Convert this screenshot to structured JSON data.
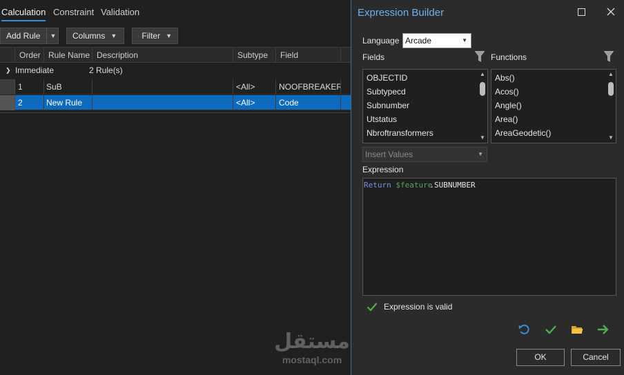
{
  "tabs": [
    "Calculation",
    "Constraint",
    "Validation"
  ],
  "toolbar": {
    "add_rule": "Add Rule",
    "columns": "Columns",
    "filter": "Filter"
  },
  "grid": {
    "columns": [
      "Order",
      "Rule Name",
      "Description",
      "Subtype",
      "Field"
    ],
    "group": {
      "name": "Immediate",
      "count": "2 Rule(s)"
    },
    "rows": [
      {
        "order": "1",
        "name": "SuB",
        "description": "",
        "subtype": "<All>",
        "field": "NOOFBREAKERS",
        "selected": false
      },
      {
        "order": "2",
        "name": "New Rule",
        "description": "",
        "subtype": "<All>",
        "field": "Code",
        "selected": true
      }
    ]
  },
  "dialog": {
    "title": "Expression Builder",
    "language_label": "Language",
    "language_value": "Arcade",
    "fields_label": "Fields",
    "functions_label": "Functions",
    "fields": [
      "OBJECTID",
      "Subtypecd",
      "Subnumber",
      "Utstatus",
      "Nbroftransformers"
    ],
    "functions": [
      "Abs()",
      "Acos()",
      "Angle()",
      "Area()",
      "AreaGeodetic()"
    ],
    "insert_values": "Insert Values",
    "expression_label": "Expression",
    "expression": {
      "keyword": "Return",
      "variable": "$feature",
      "property": ".SUBNUMBER"
    },
    "valid_text": "Expression is valid",
    "ok": "OK",
    "cancel": "Cancel"
  },
  "watermark": {
    "arabic": "مستقل",
    "latin": "mostaql.com"
  },
  "colors": {
    "accent": "#2f8fdd",
    "selection": "#0d6bbd",
    "title": "#6cb2f0",
    "valid": "#4caf50"
  }
}
